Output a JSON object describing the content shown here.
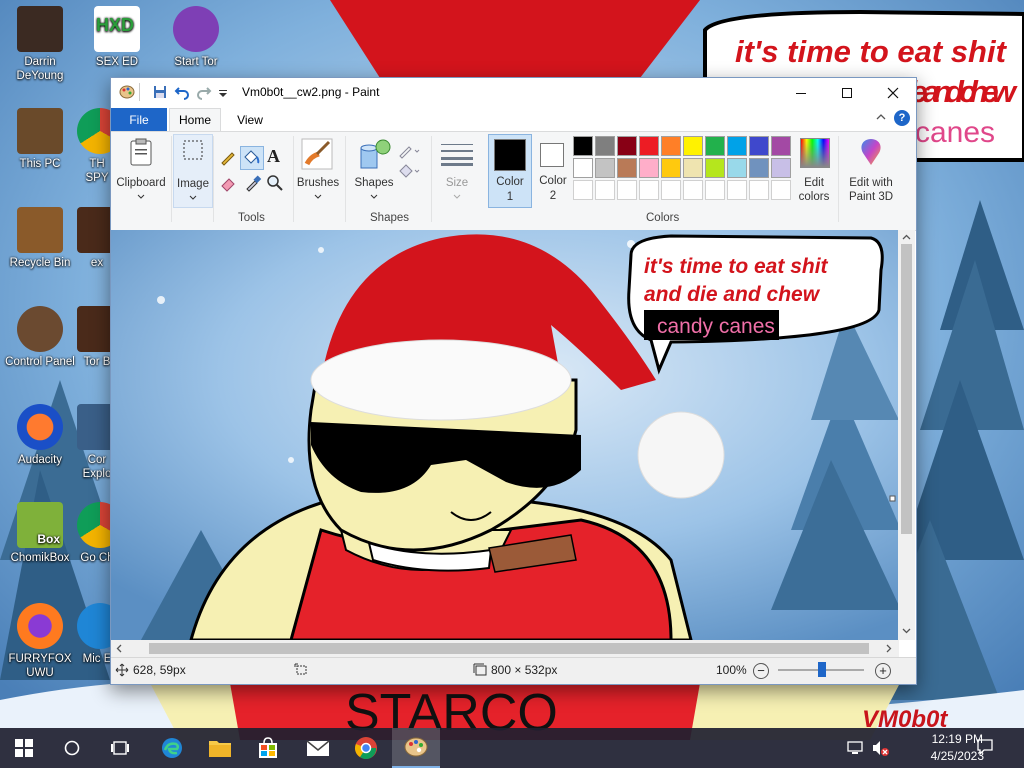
{
  "wallpaper": {
    "speech_line1": "it's time to eat shit",
    "speech_line2": "and die and chew",
    "speech_line3": "canes",
    "shirt_text": "STARCO",
    "signature": "VM0b0t"
  },
  "desktop_icons": [
    {
      "label": "Darrin DeYoung",
      "icon": "person-photo-icon"
    },
    {
      "label": "SEX ED",
      "icon": "hxd-icon"
    },
    {
      "label": "Start Tor",
      "icon": "tor-icon"
    },
    {
      "label": "This PC",
      "icon": "computer-icon"
    },
    {
      "label": "TH SPY",
      "icon": "chrome-icon"
    },
    {
      "label": "Recycle Bin",
      "icon": "recycle-bin-icon"
    },
    {
      "label": "ex",
      "icon": "book-icon"
    },
    {
      "label": "Control Panel",
      "icon": "control-panel-icon"
    },
    {
      "label": "Tor B",
      "icon": "book-icon"
    },
    {
      "label": "Audacity",
      "icon": "audacity-icon"
    },
    {
      "label": "Cor Explo",
      "icon": "folder-icon"
    },
    {
      "label": "ChomikBox",
      "icon": "chomikbox-icon"
    },
    {
      "label": "Go Ch",
      "icon": "chrome-icon"
    },
    {
      "label": "FURRYFOX UWU",
      "icon": "firefox-icon"
    },
    {
      "label": "Mic E",
      "icon": "edge-icon"
    }
  ],
  "paint": {
    "title": "Vm0b0t__cw2.png - Paint",
    "tabs": {
      "file": "File",
      "home": "Home",
      "view": "View"
    },
    "groups": {
      "clipboard": "Clipboard",
      "image": "Image",
      "tools": "Tools",
      "brushes": "Brushes",
      "shapes_btn": "Shapes",
      "shapes": "Shapes",
      "size": "Size",
      "color1": "Color",
      "color1_num": "1",
      "color2": "Color",
      "color2_num": "2",
      "colors": "Colors",
      "edit_colors": "Edit colors",
      "edit3d": "Edit with Paint 3D"
    },
    "palette": [
      "#000000",
      "#7f7f7f",
      "#880015",
      "#ed1c24",
      "#ff7f27",
      "#fff200",
      "#22b14c",
      "#00a2e8",
      "#3f48cc",
      "#a349a4",
      "#ffffff",
      "#c3c3c3",
      "#b97a57",
      "#ffaec9",
      "#ffc90e",
      "#efe4b0",
      "#b5e61d",
      "#99d9ea",
      "#7092be",
      "#c8bfe7"
    ],
    "color1_value": "#000000",
    "color2_value": "#ffffff",
    "canvas": {
      "speech_line1": "it's time to eat shit",
      "speech_line2": "and die and chew",
      "speech_line3": "candy canes"
    },
    "status": {
      "cursor_pos": "628, 59px",
      "image_size": "800 × 532px",
      "zoom": "100%"
    }
  },
  "taskbar": {
    "time": "12:19 PM",
    "date": "4/25/2023"
  }
}
